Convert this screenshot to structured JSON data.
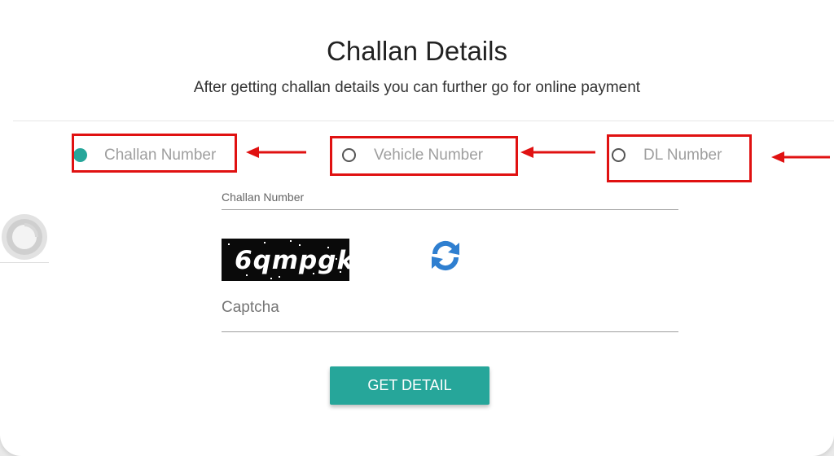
{
  "header": {
    "title": "Challan Details",
    "subtitle": "After getting challan details you can further go for online payment"
  },
  "search_type": {
    "options": [
      {
        "label": "Challan Number",
        "selected": true
      },
      {
        "label": "Vehicle Number",
        "selected": false
      },
      {
        "label": "DL Number",
        "selected": false
      }
    ]
  },
  "form": {
    "challan_number_label": "Challan Number",
    "captcha_image_text": "6qmpgk",
    "captcha_placeholder": "Captcha",
    "submit_label": "GET DETAIL"
  },
  "colors": {
    "accent": "#26a69a",
    "annotation_red": "#e01111",
    "refresh_icon": "#2f7fd0"
  }
}
